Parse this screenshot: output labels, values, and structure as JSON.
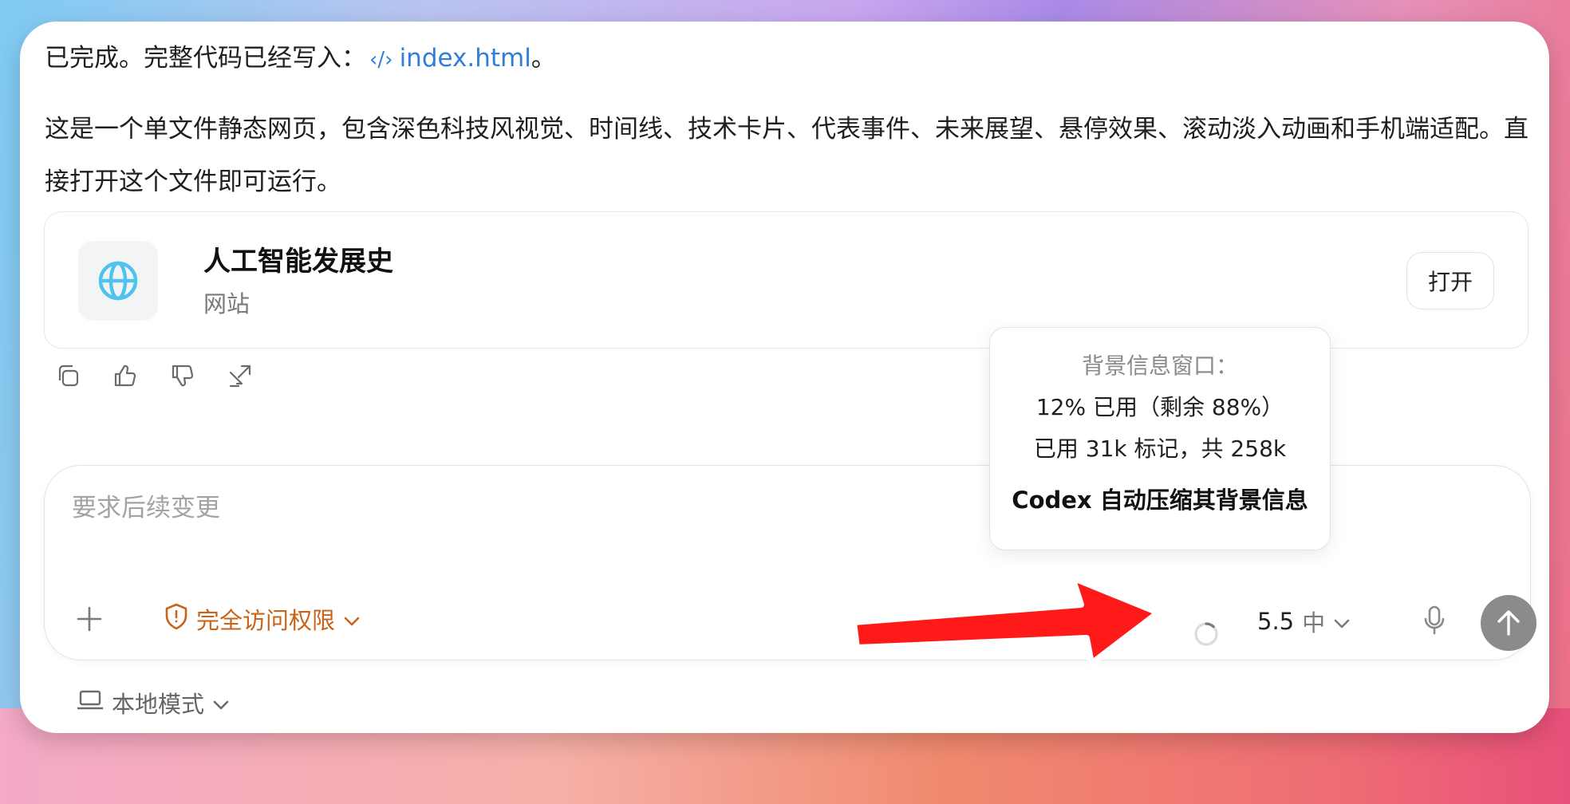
{
  "message": {
    "line1_prefix": "已完成。完整代码已经写入：",
    "file_glyph": "‹/›",
    "file_link": "index.html",
    "line1_suffix": "。",
    "line2": "这是一个单文件静态网页，包含深色科技风视觉、时间线、技术卡片、代表事件、未来展望、悬停效果、滚动淡入动画和手机端适配。直接打开这个文件即可运行。"
  },
  "card": {
    "title": "人工智能发展史",
    "subtitle": "网站",
    "open_label": "打开",
    "icon": "globe-icon",
    "accent": "#4fc3ef"
  },
  "actions": [
    "copy-icon",
    "thumbs-up-icon",
    "thumbs-down-icon",
    "share-icon"
  ],
  "composer": {
    "placeholder": "要求后续变更",
    "access_label": "完全访问权限",
    "access_color": "#c8641a",
    "model": "5.5",
    "effort": "中"
  },
  "footer": {
    "mode_label": "本地模式"
  },
  "context_tooltip": {
    "title": "背景信息窗口：",
    "usage_line": "12% 已用（剩余 88%）",
    "tokens_line": "已用 31k 标记，共 258k",
    "note": "Codex 自动压缩其背景信息"
  },
  "colors": {
    "link": "#2f7fd6",
    "send_button": "#8b8b8b",
    "annotation_arrow": "#ff1a1a"
  }
}
